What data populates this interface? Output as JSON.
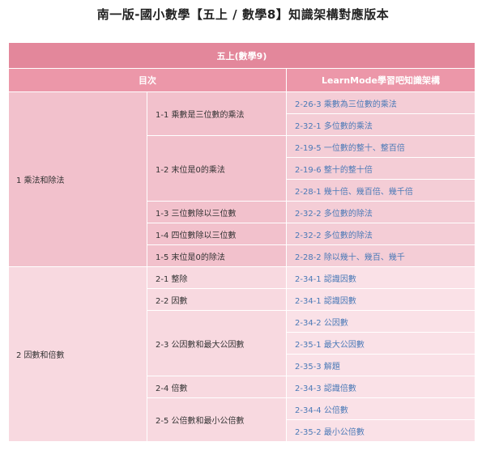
{
  "page": {
    "title": "南一版-國小數學【五上 / 數學8】知識架構對應版本"
  },
  "table": {
    "caption": "五上(數學9)",
    "headers": {
      "toc": "目次",
      "learnmode": "LearnMode學習吧知識架構"
    },
    "chapters": [
      {
        "label": "1 乘法和除法",
        "sections": [
          {
            "label": "1-1 乘數是三位數的乘法",
            "links": [
              "2-26-3 乘數為三位數的乘法",
              "2-32-1 多位數的乘法"
            ]
          },
          {
            "label": "1-2 末位是0的乘法",
            "links": [
              "2-19-5 一位數的整十、整百倍",
              "2-19-6 整十的整十倍",
              "2-28-1 幾十倍、幾百倍、幾千倍"
            ]
          },
          {
            "label": "1-3 三位數除以三位數",
            "links": [
              "2-32-2 多位數的除法"
            ]
          },
          {
            "label": "1-4 四位數除以三位數",
            "links": [
              "2-32-2 多位數的除法"
            ]
          },
          {
            "label": "1-5 末位是0的除法",
            "links": [
              "2-28-2 除以幾十、幾百、幾千"
            ]
          }
        ]
      },
      {
        "label": "2 因數和倍數",
        "sections": [
          {
            "label": "2-1 整除",
            "links": [
              "2-34-1 認識因數"
            ]
          },
          {
            "label": "2-2 因數",
            "links": [
              "2-34-1 認識因數"
            ]
          },
          {
            "label": "2-3 公因數和最大公因數",
            "links": [
              "2-34-2 公因數",
              "2-35-1 最大公因數",
              "2-35-3 解題"
            ]
          },
          {
            "label": "2-4 倍數",
            "links": [
              "2-34-3 認識倍數"
            ]
          },
          {
            "label": "2-5 公倍數和最小公倍數",
            "links": [
              "2-34-4 公倍數",
              "2-35-2 最小公倍數"
            ]
          }
        ]
      }
    ]
  },
  "colors": {
    "caption_bg": "#e3879b",
    "header_bg": "#ec97a9",
    "group1_bg": "#f2c1cc",
    "group2_bg": "#f8d9e0",
    "link_text": "#4a79b7"
  }
}
